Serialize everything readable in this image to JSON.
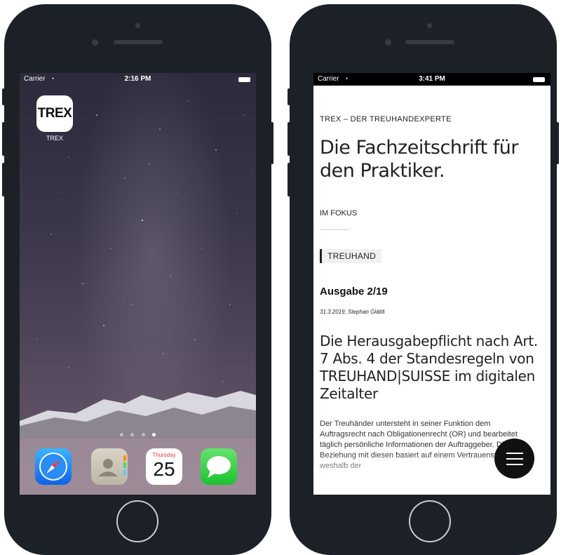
{
  "left_phone": {
    "status": {
      "carrier": "Carrier",
      "time": "2:16 PM"
    },
    "app": {
      "icon_text": "TREX",
      "label": "TREX"
    },
    "page_indicator": {
      "count": 4,
      "active": 3
    },
    "dock": {
      "apps": [
        "Safari",
        "Contacts",
        "Calendar",
        "Messages"
      ],
      "calendar_day": "Thursday",
      "calendar_date": "25"
    }
  },
  "right_phone": {
    "status": {
      "carrier": "Carrier",
      "time": "3:41 PM"
    },
    "brand": "TREX – DER TREUHANDEXPERTE",
    "headline": "Die Fachzeitschrift für den Praktiker.",
    "focus_label": "IM FOKUS",
    "tag": "TREUHAND",
    "issue": "Ausgabe 2/19",
    "byline": "31.3.2019, Stephan Glättli",
    "article_title": "Die Herausgabepflicht nach Art. 7 Abs. 4 der Standesregeln von TREUHAND|SUISSE im digitalen Zeitalter",
    "body": "Der Treuhänder untersteht in seiner Funktion dem Auftragsrecht nach Obligationenrecht (OR) und bearbeitet täglich persönliche Informationen der Auftraggeber. Die Beziehung mit diesen basiert auf einem Vertrauensverhältnis, weshalb der"
  },
  "colors": {
    "phone_body": "#1c2128",
    "home_button_ring": "#c6cad2",
    "menu_button": "#111111",
    "tag_bar": "#222222"
  },
  "icons": {
    "wifi": "wifi-icon",
    "battery": "battery-icon",
    "menu": "hamburger-menu-icon"
  }
}
